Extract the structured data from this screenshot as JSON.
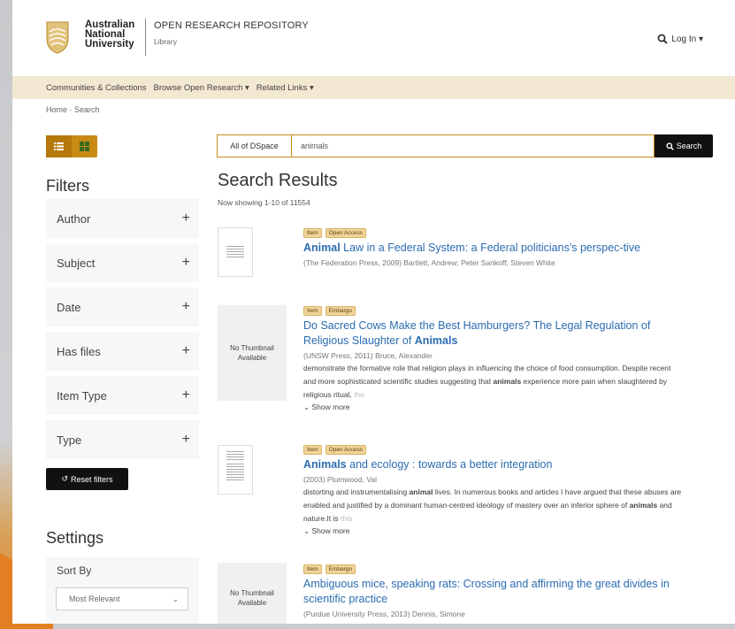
{
  "header": {
    "university": [
      "Australian",
      "National",
      "University"
    ],
    "repo_title": "OPEN RESEARCH REPOSITORY",
    "repo_subtitle": "Library",
    "login_label": "Log In ▾"
  },
  "nav": {
    "items": [
      "Communities & Collections",
      "Browse Open Research ▾",
      "Related Links ▾"
    ]
  },
  "breadcrumb": "Home · Search",
  "filters": {
    "title": "Filters",
    "items": [
      "Author",
      "Subject",
      "Date",
      "Has files",
      "Item Type",
      "Type"
    ],
    "reset_label": "Reset filters"
  },
  "settings": {
    "title": "Settings",
    "sort_by_label": "Sort By",
    "sort_value": "Most Relevant"
  },
  "search": {
    "scope": "All of DSpace",
    "query": "animals",
    "button_label": "Search"
  },
  "results_header": {
    "title": "Search Results",
    "count": "Now showing 1-10 of 11554"
  },
  "results": [
    {
      "badges": [
        "Item",
        "Open Access"
      ],
      "title_bold": "Animal",
      "title_rest": " Law in a Federal System: a Federal politicians's perspec-tive",
      "meta": "(The Federation Press, 2009) Bartlett, Andrew; Peter Sankoff; Steven White"
    },
    {
      "badges": [
        "Item",
        "Embargo"
      ],
      "title_rest": "Do Sacred Cows Make the Best Hamburgers? The Legal Regulation of Religious Slaughter of ",
      "title_bold_end": "Animals",
      "meta": "(UNSW Press, 2011) Bruce, Alexander",
      "abstract_1": "demonstrate the formative role that religion plays in influencing the choice of food consumption. Despite recent and more sophisticated scientific studies suggesting that ",
      "abstract_bold": "animals",
      "abstract_2": " experience more pain when slaughtered by religious ritual, ",
      "abstract_fade": "the",
      "show_more": "Show more",
      "thumb": "No Thumbnail Available"
    },
    {
      "badges": [
        "Item",
        "Open Access"
      ],
      "title_bold": "Animals",
      "title_rest": " and ecology : towards a better integration",
      "meta": "(2003) Plumwood, Val",
      "abstract_1": "distorting and instrumentalising ",
      "abstract_bold": "animal",
      "abstract_2": " lives. In numerous books and articles I have argued that these abuses are enabled and justified by a dominant human-centred ideology of mastery over an inferior sphere of ",
      "abstract_bold2": "animals",
      "abstract_3": " and nature.It is ",
      "abstract_fade": "this",
      "show_more": "Show more"
    },
    {
      "badges": [
        "Item",
        "Embargo"
      ],
      "title_rest": "Ambiguous mice, speaking rats: Crossing and affirming the great divides in scientific practice",
      "meta": "(Purdue University Press, 2013) Dennis, Simone",
      "thumb": "No Thumbnail Available"
    }
  ],
  "colors": {
    "accent": "#c88b16",
    "nav_bg": "#f3e8d2",
    "link": "#2b6cb0",
    "button_dark": "#111111"
  }
}
